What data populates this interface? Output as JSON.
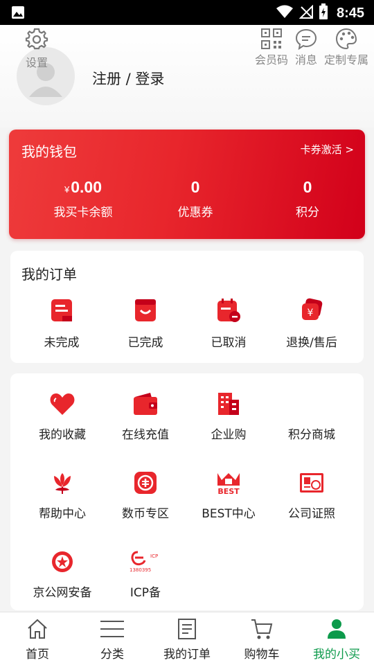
{
  "status_bar": {
    "time": "8:45"
  },
  "header": {
    "settings_label": "设置",
    "login_text": "注册 / 登录",
    "actions": [
      {
        "label": "会员码",
        "icon": "qrcode-icon"
      },
      {
        "label": "消息",
        "icon": "message-icon"
      },
      {
        "label": "定制专属",
        "icon": "palette-icon"
      }
    ]
  },
  "wallet": {
    "title": "我的钱包",
    "activate_label": "卡券激活 >",
    "stats": [
      {
        "currency": "¥",
        "value": "0.00",
        "label": "我买卡余额"
      },
      {
        "currency": "",
        "value": "0",
        "label": "优惠券"
      },
      {
        "currency": "",
        "value": "0",
        "label": "积分"
      }
    ]
  },
  "orders": {
    "title": "我的订单",
    "items": [
      {
        "label": "未完成",
        "icon": "pending-order-icon"
      },
      {
        "label": "已完成",
        "icon": "completed-order-icon"
      },
      {
        "label": "已取消",
        "icon": "cancelled-order-icon"
      },
      {
        "label": "退换/售后",
        "icon": "refund-icon"
      }
    ]
  },
  "services": {
    "items": [
      {
        "label": "我的收藏",
        "icon": "heart-icon"
      },
      {
        "label": "在线充值",
        "icon": "wallet-icon"
      },
      {
        "label": "企业购",
        "icon": "building-icon"
      },
      {
        "label": "积分商城",
        "icon": ""
      },
      {
        "label": "帮助中心",
        "icon": "flower-icon"
      },
      {
        "label": "数币专区",
        "icon": "digital-currency-icon"
      },
      {
        "label": "BEST中心",
        "icon": "best-crown-icon"
      },
      {
        "label": "公司证照",
        "icon": "license-icon"
      },
      {
        "label": "京公网安备",
        "icon": "police-emblem-icon"
      },
      {
        "label": "ICP备",
        "icon": "icp-logo-icon"
      }
    ],
    "best_logo_text": "BEST",
    "icp_logo_text": "1380395",
    "icp_logo_small": "ICP"
  },
  "tabbar": {
    "tabs": [
      {
        "label": "首页",
        "icon": "home-icon"
      },
      {
        "label": "分类",
        "icon": "list-icon"
      },
      {
        "label": "我的订单",
        "icon": "document-icon"
      },
      {
        "label": "购物车",
        "icon": "cart-icon"
      },
      {
        "label": "我的小买",
        "icon": "profile-icon"
      }
    ],
    "active_tab": "我的小买"
  },
  "colors": {
    "brand_red": "#e8262c",
    "active_green": "#0d9a4b",
    "icon_gray": "#666666"
  }
}
